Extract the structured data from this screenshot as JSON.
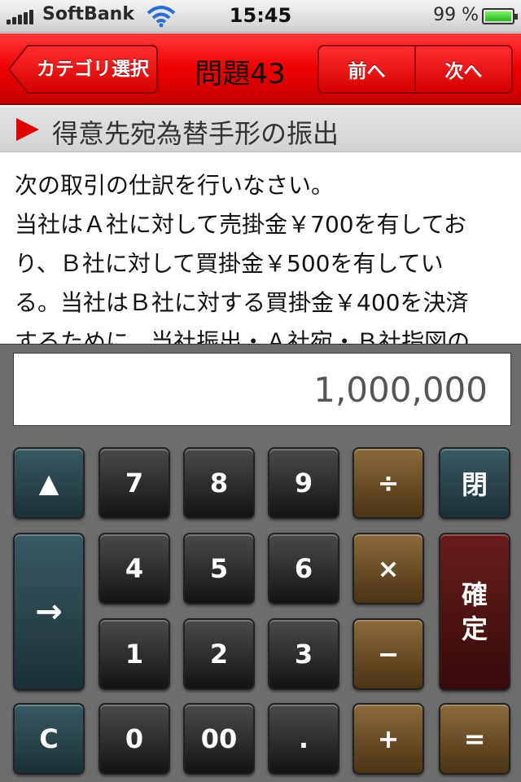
{
  "status_bar": {
    "carrier": "SoftBank",
    "time": "15:45",
    "battery_percent": "99 %",
    "battery_level": 0.99,
    "icons": [
      "signal-icon",
      "wifi-icon",
      "battery-icon"
    ]
  },
  "nav": {
    "back_label": "カテゴリ選択",
    "title": "問題43",
    "prev_label": "前へ",
    "next_label": "次へ"
  },
  "section": {
    "title": "得意先宛為替手形の振出",
    "accent_color": "#e00000"
  },
  "question": {
    "lines": [
      "次の取引の仕訳を行いなさい。",
      "当社はＡ社に対して売掛金￥700を有してお",
      "り、Ｂ社に対して買掛金￥500を有してい",
      "る。当社はＢ社に対する買掛金￥400を決済",
      "するために、当社振出・Ａ社宛・Ｂ社指図の"
    ]
  },
  "calculator": {
    "display": "1,000,000",
    "keys": {
      "up": "▲",
      "seven": "7",
      "eight": "8",
      "nine": "9",
      "divide": "÷",
      "close": "閉",
      "four": "4",
      "five": "5",
      "six": "6",
      "multiply": "×",
      "enter_arrow": "→",
      "confirm": "確定",
      "one": "1",
      "two": "2",
      "three": "3",
      "minus": "−",
      "clear": "C",
      "zero": "0",
      "double_zero": "00",
      "dot": ".",
      "plus": "+",
      "equals": "="
    }
  }
}
